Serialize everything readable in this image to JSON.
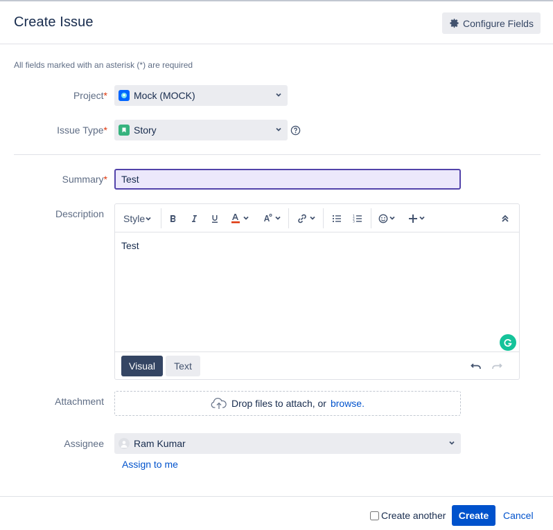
{
  "dialog": {
    "title": "Create Issue",
    "configure_fields_label": "Configure Fields",
    "required_note": "All fields marked with an asterisk (*) are required"
  },
  "fields": {
    "project": {
      "label": "Project",
      "required_marker": "*",
      "value": "Mock (MOCK)",
      "icon": "project-avatar-icon"
    },
    "issue_type": {
      "label": "Issue Type",
      "required_marker": "*",
      "value": "Story",
      "icon": "story-icon"
    },
    "summary": {
      "label": "Summary",
      "required_marker": "*",
      "value": "Test"
    },
    "description": {
      "label": "Description",
      "style_label": "Style",
      "content": "Test",
      "mode_visual": "Visual",
      "mode_text": "Text"
    },
    "attachment": {
      "label": "Attachment",
      "drop_text": "Drop files to attach, or",
      "browse_link": "browse."
    },
    "assignee": {
      "label": "Assignee",
      "value": "Ram Kumar",
      "assign_to_me": "Assign to me"
    }
  },
  "footer": {
    "create_another_label": "Create another",
    "create_another_checked": false,
    "create_label": "Create",
    "cancel_label": "Cancel"
  },
  "colors": {
    "primary": "#0052cc",
    "required": "#de350b",
    "summary_focus_border": "#5243aa",
    "story_icon": "#36b37e",
    "grammarly": "#15c39a"
  }
}
